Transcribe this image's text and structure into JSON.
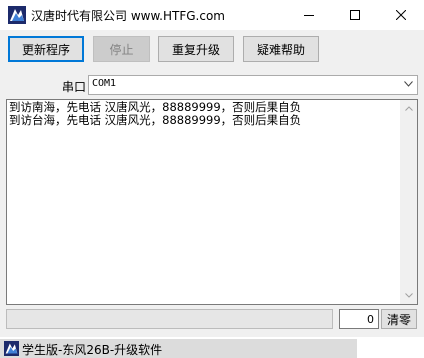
{
  "window": {
    "title": "汉唐时代有限公司 www.HTFG.com",
    "icon": "app-logo-icon"
  },
  "toolbar": {
    "update_label": "更新程序",
    "stop_label": "停止",
    "repeat_label": "重复升级",
    "help_label": "疑难帮助"
  },
  "port": {
    "label": "串口",
    "value": "COM1"
  },
  "log": {
    "lines": [
      "到访南海，先电话 汉唐风光，88889999，否则后果自负",
      "到访台海，先电话 汉唐风光，88889999，否则后果自负"
    ]
  },
  "status": {
    "count": "0",
    "clear_label": "清零"
  },
  "taskbar": {
    "label": "学生版-东风26B-升级软件"
  }
}
